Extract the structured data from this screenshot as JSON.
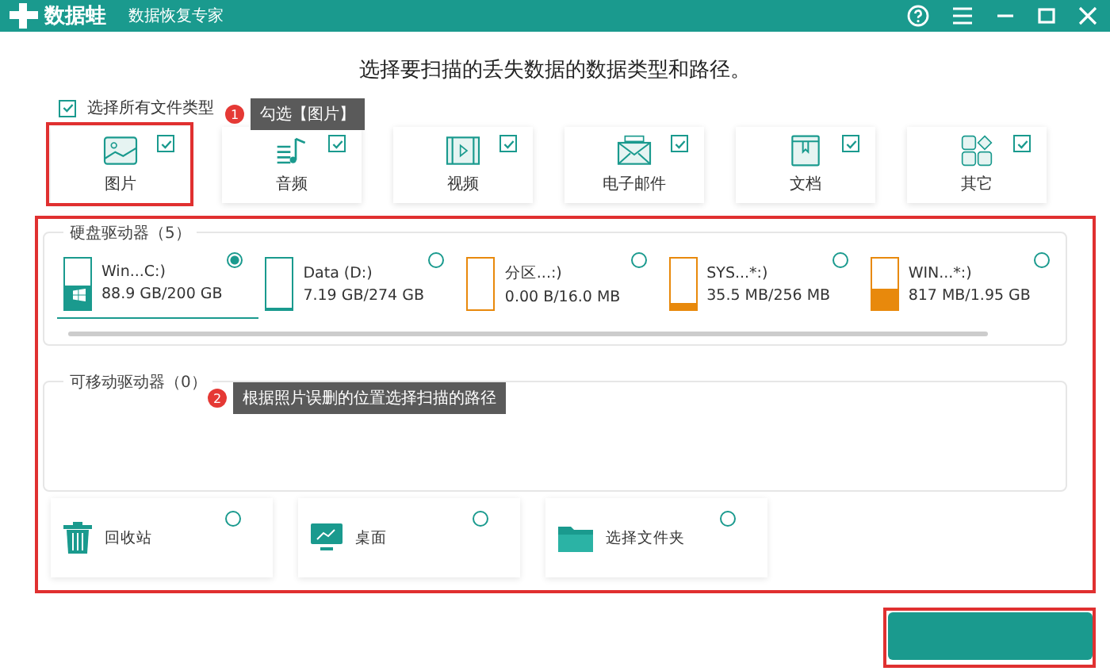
{
  "window": {
    "app_name": "数据蛙",
    "subtitle": "数据恢复专家"
  },
  "heading": "选择要扫描的丢失数据的数据类型和路径。",
  "select_all": {
    "label": "选择所有文件类型",
    "checked": true
  },
  "file_types": [
    {
      "label": "图片",
      "kind": "image",
      "checked": true
    },
    {
      "label": "音频",
      "kind": "audio",
      "checked": true
    },
    {
      "label": "视频",
      "kind": "video",
      "checked": true
    },
    {
      "label": "电子邮件",
      "kind": "email",
      "checked": true
    },
    {
      "label": "文档",
      "kind": "document",
      "checked": true
    },
    {
      "label": "其它",
      "kind": "other",
      "checked": true
    }
  ],
  "hard_drives": {
    "title": "硬盘驱动器（5）",
    "items": [
      {
        "name": "Win...C:)",
        "size": "88.9 GB/200 GB",
        "level": 0.45,
        "color": "#1a9a8e",
        "system": true,
        "selected": true
      },
      {
        "name": "Data (D:)",
        "size": "7.19 GB/274 GB",
        "level": 0.03,
        "color": "#1a9a8e",
        "system": false,
        "selected": false
      },
      {
        "name": "分区...:)",
        "size": "0.00  B/16.0 MB",
        "level": 0,
        "color": "#e8890c",
        "system": false,
        "selected": false
      },
      {
        "name": "SYS...*:)",
        "size": "35.5 MB/256 MB",
        "level": 0.14,
        "color": "#e8890c",
        "system": false,
        "selected": false
      },
      {
        "name": "WIN...*:)",
        "size": "817 MB/1.95 GB",
        "level": 0.42,
        "color": "#e8890c",
        "system": false,
        "selected": false
      }
    ]
  },
  "removable_drives": {
    "title": "可移动驱动器（0）"
  },
  "locations": [
    {
      "label": "回收站",
      "kind": "trash",
      "selected": false
    },
    {
      "label": "桌面",
      "kind": "desktop",
      "selected": false
    },
    {
      "label": "选择文件夹",
      "kind": "folder",
      "selected": false
    }
  ],
  "annotations": [
    {
      "number": "1",
      "text": "勾选【图片】"
    },
    {
      "number": "2",
      "text": "根据照片误删的位置选择扫描的路径"
    }
  ]
}
